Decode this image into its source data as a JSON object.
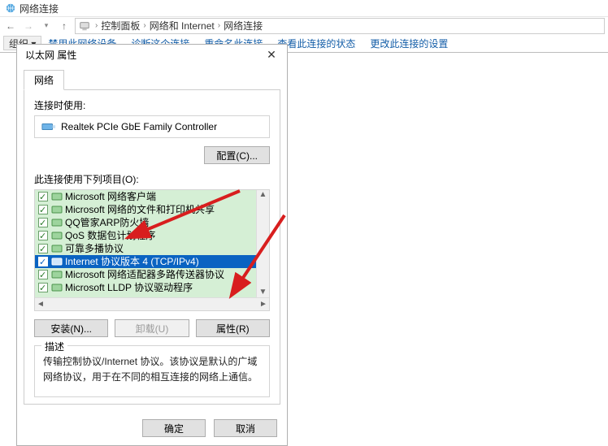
{
  "window": {
    "title": "网络连接"
  },
  "breadcrumb": {
    "segs": [
      "控制面板",
      "网络和 Internet",
      "网络连接"
    ]
  },
  "toolbar": {
    "organize": "组织 ▾",
    "links": [
      "禁用此网络设备",
      "诊断这个连接",
      "重命名此连接",
      "查看此连接的状态",
      "更改此连接的设置"
    ]
  },
  "dialog": {
    "title": "以太网 属性",
    "tabs": {
      "network": "网络"
    },
    "connect_using_label": "连接时使用:",
    "adapter": "Realtek PCIe GbE Family Controller",
    "configure_btn": "配置(C)...",
    "items_label": "此连接使用下列项目(O):",
    "items": [
      {
        "label": "Microsoft 网络客户端",
        "selected": false
      },
      {
        "label": "Microsoft 网络的文件和打印机共享",
        "selected": false
      },
      {
        "label": "QQ管家ARP防火墙",
        "selected": false
      },
      {
        "label": "QoS 数据包计划程序",
        "selected": false
      },
      {
        "label": "可靠多播协议",
        "selected": false
      },
      {
        "label": "Internet 协议版本 4 (TCP/IPv4)",
        "selected": true
      },
      {
        "label": "Microsoft 网络适配器多路传送器协议",
        "selected": false
      },
      {
        "label": "Microsoft LLDP 协议驱动程序",
        "selected": false
      }
    ],
    "install_btn": "安装(N)...",
    "uninstall_btn": "卸载(U)",
    "properties_btn": "属性(R)",
    "desc_legend": "描述",
    "desc_text": "传输控制协议/Internet 协议。该协议是默认的广域网络协议，用于在不同的相互连接的网络上通信。",
    "ok_btn": "确定",
    "cancel_btn": "取消"
  }
}
